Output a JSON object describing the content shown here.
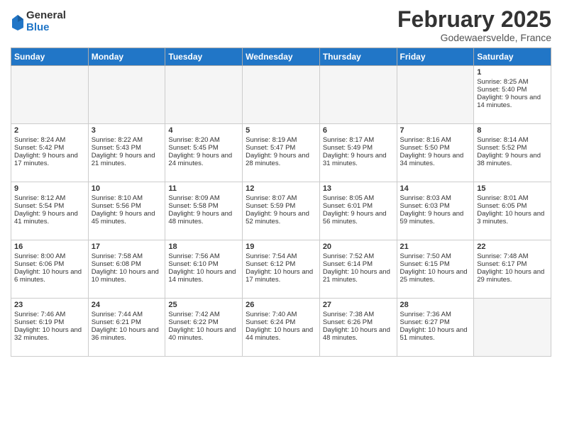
{
  "header": {
    "logo_general": "General",
    "logo_blue": "Blue",
    "title": "February 2025",
    "location": "Godewaersvelde, France"
  },
  "days_of_week": [
    "Sunday",
    "Monday",
    "Tuesday",
    "Wednesday",
    "Thursday",
    "Friday",
    "Saturday"
  ],
  "weeks": [
    [
      {
        "day": "",
        "empty": true
      },
      {
        "day": "",
        "empty": true
      },
      {
        "day": "",
        "empty": true
      },
      {
        "day": "",
        "empty": true
      },
      {
        "day": "",
        "empty": true
      },
      {
        "day": "",
        "empty": true
      },
      {
        "day": "1",
        "sunrise": "8:25 AM",
        "sunset": "5:40 PM",
        "daylight": "9 hours and 14 minutes."
      }
    ],
    [
      {
        "day": "2",
        "sunrise": "8:24 AM",
        "sunset": "5:42 PM",
        "daylight": "9 hours and 17 minutes."
      },
      {
        "day": "3",
        "sunrise": "8:22 AM",
        "sunset": "5:43 PM",
        "daylight": "9 hours and 21 minutes."
      },
      {
        "day": "4",
        "sunrise": "8:20 AM",
        "sunset": "5:45 PM",
        "daylight": "9 hours and 24 minutes."
      },
      {
        "day": "5",
        "sunrise": "8:19 AM",
        "sunset": "5:47 PM",
        "daylight": "9 hours and 28 minutes."
      },
      {
        "day": "6",
        "sunrise": "8:17 AM",
        "sunset": "5:49 PM",
        "daylight": "9 hours and 31 minutes."
      },
      {
        "day": "7",
        "sunrise": "8:16 AM",
        "sunset": "5:50 PM",
        "daylight": "9 hours and 34 minutes."
      },
      {
        "day": "8",
        "sunrise": "8:14 AM",
        "sunset": "5:52 PM",
        "daylight": "9 hours and 38 minutes."
      }
    ],
    [
      {
        "day": "9",
        "sunrise": "8:12 AM",
        "sunset": "5:54 PM",
        "daylight": "9 hours and 41 minutes."
      },
      {
        "day": "10",
        "sunrise": "8:10 AM",
        "sunset": "5:56 PM",
        "daylight": "9 hours and 45 minutes."
      },
      {
        "day": "11",
        "sunrise": "8:09 AM",
        "sunset": "5:58 PM",
        "daylight": "9 hours and 48 minutes."
      },
      {
        "day": "12",
        "sunrise": "8:07 AM",
        "sunset": "5:59 PM",
        "daylight": "9 hours and 52 minutes."
      },
      {
        "day": "13",
        "sunrise": "8:05 AM",
        "sunset": "6:01 PM",
        "daylight": "9 hours and 56 minutes."
      },
      {
        "day": "14",
        "sunrise": "8:03 AM",
        "sunset": "6:03 PM",
        "daylight": "9 hours and 59 minutes."
      },
      {
        "day": "15",
        "sunrise": "8:01 AM",
        "sunset": "6:05 PM",
        "daylight": "10 hours and 3 minutes."
      }
    ],
    [
      {
        "day": "16",
        "sunrise": "8:00 AM",
        "sunset": "6:06 PM",
        "daylight": "10 hours and 6 minutes."
      },
      {
        "day": "17",
        "sunrise": "7:58 AM",
        "sunset": "6:08 PM",
        "daylight": "10 hours and 10 minutes."
      },
      {
        "day": "18",
        "sunrise": "7:56 AM",
        "sunset": "6:10 PM",
        "daylight": "10 hours and 14 minutes."
      },
      {
        "day": "19",
        "sunrise": "7:54 AM",
        "sunset": "6:12 PM",
        "daylight": "10 hours and 17 minutes."
      },
      {
        "day": "20",
        "sunrise": "7:52 AM",
        "sunset": "6:14 PM",
        "daylight": "10 hours and 21 minutes."
      },
      {
        "day": "21",
        "sunrise": "7:50 AM",
        "sunset": "6:15 PM",
        "daylight": "10 hours and 25 minutes."
      },
      {
        "day": "22",
        "sunrise": "7:48 AM",
        "sunset": "6:17 PM",
        "daylight": "10 hours and 29 minutes."
      }
    ],
    [
      {
        "day": "23",
        "sunrise": "7:46 AM",
        "sunset": "6:19 PM",
        "daylight": "10 hours and 32 minutes."
      },
      {
        "day": "24",
        "sunrise": "7:44 AM",
        "sunset": "6:21 PM",
        "daylight": "10 hours and 36 minutes."
      },
      {
        "day": "25",
        "sunrise": "7:42 AM",
        "sunset": "6:22 PM",
        "daylight": "10 hours and 40 minutes."
      },
      {
        "day": "26",
        "sunrise": "7:40 AM",
        "sunset": "6:24 PM",
        "daylight": "10 hours and 44 minutes."
      },
      {
        "day": "27",
        "sunrise": "7:38 AM",
        "sunset": "6:26 PM",
        "daylight": "10 hours and 48 minutes."
      },
      {
        "day": "28",
        "sunrise": "7:36 AM",
        "sunset": "6:27 PM",
        "daylight": "10 hours and 51 minutes."
      },
      {
        "day": "",
        "empty": true
      }
    ]
  ]
}
